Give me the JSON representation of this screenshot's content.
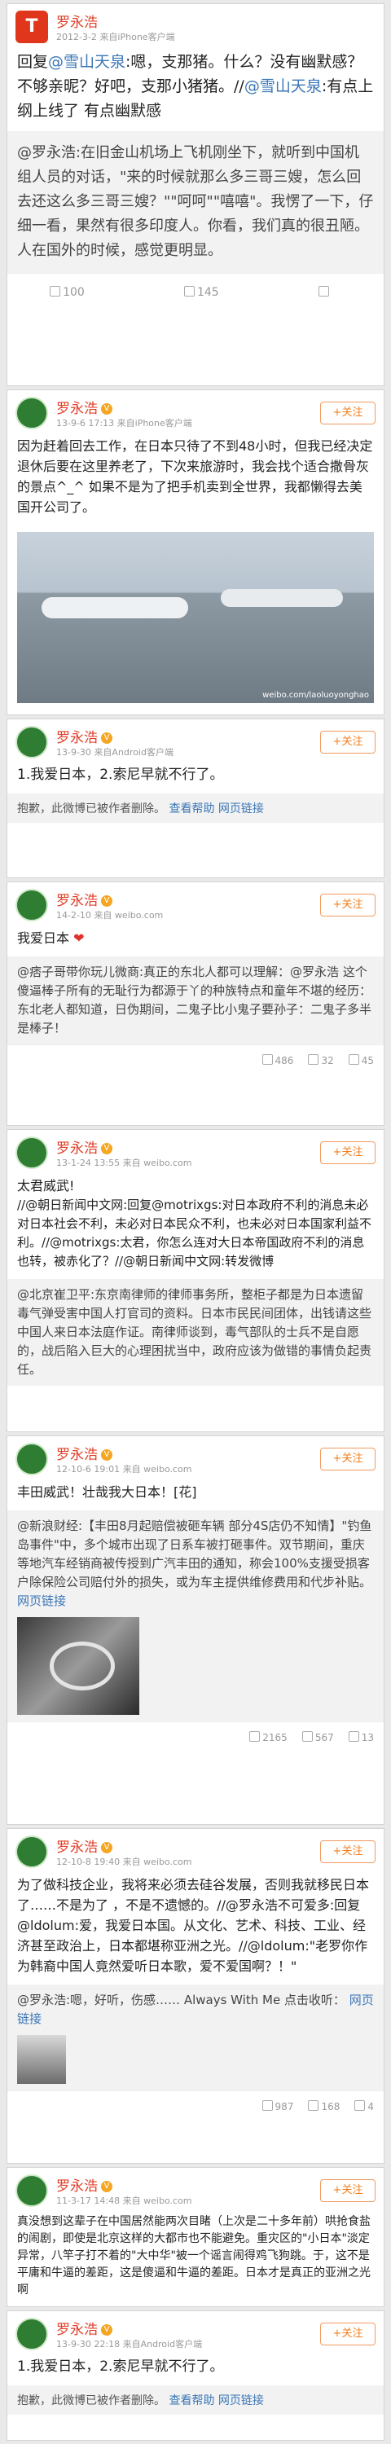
{
  "follow_label": "+关注",
  "cards": [
    {
      "user": "罗永浩",
      "time": "2012-3-2",
      "source": "来自iPhone客户端",
      "text_a": "回复",
      "mention_a": "@雪山天泉",
      "text_b": ":嗯，支那猪。什么？没有幽默感？不够亲昵？好吧，支那小猪猪。//",
      "mention_b": "@雪山天泉",
      "text_c": ":有点上纲上线了 有点幽默感",
      "repost": "@罗永浩:在旧金山机场上飞机刚坐下，就听到中国机组人员的对话，\"来的时候就那么多三哥三嫂，怎么回去还这么多三哥三嫂？\"\"呵呵\"\"嘻嘻\"。我愣了一下，仔细一看，果然有很多印度人。你看，我们真的很丑陋。人在国外的时候，感觉更明显。",
      "likes": "100",
      "comments": "145"
    },
    {
      "user": "罗永浩",
      "time": "13-9-6 17:13",
      "source": "来自iPhone客户端",
      "text": "因为赶着回去工作，在日本只待了不到48小时，但我已经决定退休后要在这里养老了，下次来旅游时，我会找个适合撒骨灰的景点^_^ 如果不是为了把手机卖到全世界，我都懒得去美国开公司了。",
      "watermark": "weibo.com/laoluoyonghao"
    },
    {
      "user": "罗永浩",
      "time": "13-9-30",
      "source": "来自Android客户端",
      "text": "1.我爱日本，2.索尼早就不行了。",
      "deleted": "抱歉，此微博已被作者删除。",
      "detail": "查看帮助",
      "link": "网页链接"
    },
    {
      "user": "罗永浩",
      "time": "14-2-10",
      "source": "来自 weibo.com",
      "text": "我爱日本",
      "repost": "@痞子哥带你玩儿微商:真正的东北人都可以理解：@罗永浩 这个傻逼棒子所有的无耻行为都源于丫的种族特点和童年不堪的经历：东北老人都知道，日伪期间，二鬼子比小鬼子要孙子：二鬼子多半是棒子！",
      "reposts": "486",
      "comments": "32",
      "likes": "45"
    },
    {
      "user": "罗永浩",
      "time": "13-1-24 13:55",
      "source": "来自 weibo.com",
      "text": "太君威武!",
      "text2": "//@朝日新闻中文网:回复@motrixgs:对日本政府不利的消息未必对日本社会不利，未必对日本民众不利，也未必对日本国家利益不利。//@motrixgs:太君，你怎么连对大日本帝国政府不利的消息也转，被赤化了？//@朝日新闻中文网:转发微博",
      "repost": "@北京崔卫平:东京南律师的律师事务所，整柜子都是为日本遗留毒气弹受害中国人打官司的资料。日本市民民间团体，出钱请这些中国人来日本法庭作证。南律师谈到，毒气部队的士兵不是自愿的，战后陷入巨大的心理困扰当中，政府应该为做错的事情负起责任。"
    },
    {
      "user": "罗永浩",
      "time": "12-10-6 19:01",
      "source": "来自 weibo.com",
      "text": "丰田威武！壮哉我大日本！[花]",
      "repost": "@新浪财经:【丰田8月起赔偿被砸车辆 部分4S店仍不知情】\"钓鱼岛事件\"中，多个城市出现了日系车被打砸事件。双节期间，重庆等地汽车经销商被传授到广汽丰田的通知，称会100%支援受损客户除保险公司赔付外的损失，或为车主提供维修费用和代步补贴。",
      "link": "网页链接",
      "reposts": "2165",
      "comments": "567",
      "likes": "13"
    },
    {
      "user": "罗永浩",
      "time": "12-10-8 19:40",
      "source": "来自 weibo.com",
      "text": "为了做科技企业，我将来必须去硅谷发展，否则我就移民日本了……不是为了 ，不是不遗憾的。//@罗永浩不可爱多:回复@ldolum:爱，我爱日本国。从文化、艺术、科技、工业、经济甚至政治上，日本都堪称亚洲之光。//@ldolum:\"老罗你作为韩裔中国人竟然爱听日本歌，爱不爱国啊？！\"",
      "repost": "@罗永浩:嗯，好听，伤感…… Always With Me 点击收听：",
      "link": "网页链接",
      "reposts": "987",
      "comments": "168",
      "likes": "4"
    },
    {
      "user": "罗永浩",
      "time": "11-3-17 14:48",
      "source": "来自 weibo.com",
      "text": "真没想到这辈子在中国居然能两次目睹（上次是二十多年前）哄抢食盐的闹剧，即使是北京这样的大都市也不能避免。重灾区的\"小日本\"淡定异常，八竿子打不着的\"大中华\"被一个谣言闹得鸡飞狗跳。于，这不是平庸和牛逼的差距，这是傻逼和牛逼的差距。日本才是真正的亚洲之光啊"
    },
    {
      "user": "罗永浩",
      "time": "13-9-30 22:18",
      "source": "来自Android客户端",
      "text": "1.我爱日本，2.索尼早就不行了。",
      "deleted": "抱歉，此微博已被作者删除。",
      "detail": "查看帮助",
      "link": "网页链接"
    }
  ]
}
